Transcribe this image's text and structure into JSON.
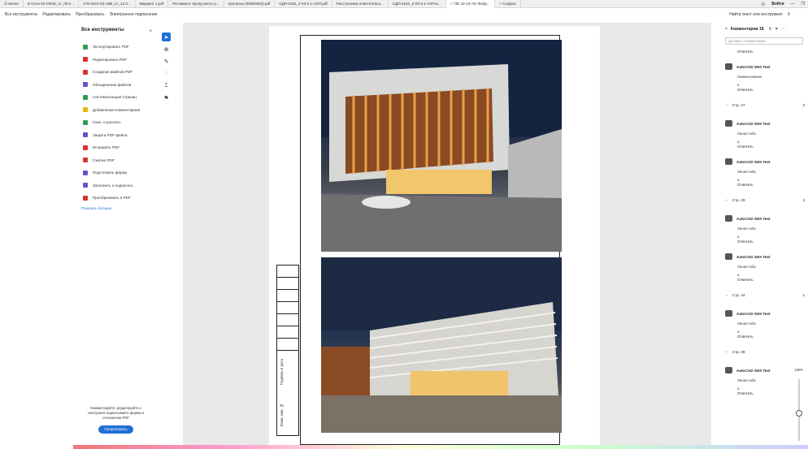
{
  "tabs": [
    {
      "label": "☰ Меню"
    },
    {
      "label": "E-Сети 03 УКОБ_от_05.0..."
    },
    {
      "label": "179-2021-03-АКБ_от_12.0..."
    },
    {
      "label": "Вариант 1.pdf"
    },
    {
      "label": "Регламент пропускного р..."
    },
    {
      "label": "пропуска (00000003).pdf"
    },
    {
      "label": "СДП-1162_2-03-3.1-АХП.pdf"
    },
    {
      "label": "Расстановка осветительн..."
    },
    {
      "label": "СДП-1162_2-03-3.1-АХП-в..."
    },
    {
      "label": "☆ ПЕ 42-10-АО Фабр..."
    },
    {
      "label": "+ Создать"
    }
  ],
  "window": {
    "help": "⓪",
    "login": "Войти",
    "minimize": "—",
    "restore": "❐"
  },
  "menubar": {
    "items": [
      "Все инструменты",
      "Редактировать",
      "Преобразовать",
      "Электронное подписание"
    ],
    "find": "Найти текст или инструмент",
    "find_icon": "search-icon"
  },
  "left_panel": {
    "title": "Все инструменты",
    "close": "×",
    "tools": [
      {
        "label": "Экспортировать PDF",
        "color": "#2e9e4f"
      },
      {
        "label": "Редактировать PDF",
        "color": "#d9342b"
      },
      {
        "label": "Создание файлов PDF",
        "color": "#d9342b"
      },
      {
        "label": "Объединение файлов",
        "color": "#6b4fd1"
      },
      {
        "label": "Систематизация страниц",
        "color": "#2e9e4f"
      },
      {
        "label": "Добавление комментариев",
        "color": "#e6b800"
      },
      {
        "label": "Скан. и распозн.",
        "color": "#2e9e4f"
      },
      {
        "label": "Защита PDF-файла",
        "color": "#6b4fd1"
      },
      {
        "label": "Исправить PDF",
        "color": "#d9342b"
      },
      {
        "label": "Сжатие PDF",
        "color": "#d9342b"
      },
      {
        "label": "Подготовить форму",
        "color": "#6b4fd1"
      },
      {
        "label": "Заполнить и подписать",
        "color": "#6b4fd1"
      },
      {
        "label": "Преобразовать в PDF",
        "color": "#d9342b"
      }
    ],
    "show_more": "Показать больше",
    "promo_text": "Комментируйте, редактируйте и электронно подписывайте формы и соглашения PDF",
    "promo_button": "Попробовать"
  },
  "vertical_tools": [
    "cursor-icon",
    "zoom-icon",
    "pen-icon",
    "lasso-icon",
    "text-select-icon",
    "stamp-icon"
  ],
  "document": {
    "stamp_labels": [
      "Подпись и дата",
      "Взам. инв. №"
    ]
  },
  "comments_panel": {
    "title": "Комментарии 18",
    "add_placeholder": "Добавить комментарий",
    "first_reply": "Ответить",
    "groups": [
      {
        "page": null,
        "count": null,
        "comments": [
          {
            "author": "AutoCAD SHX Text",
            "text": "Наименование",
            "a": "а",
            "reply": "Ответить"
          }
        ]
      },
      {
        "page": "Стр. 27",
        "count": "2",
        "comments": [
          {
            "author": "AutoCAD SHX Text",
            "text": "Линия гиба",
            "a": "а",
            "reply": "Ответить"
          },
          {
            "author": "AutoCAD SHX Text",
            "text": "Линия гиба",
            "a": "а",
            "reply": "Ответить"
          }
        ]
      },
      {
        "page": "Стр. 29",
        "count": "2",
        "comments": [
          {
            "author": "AutoCAD SHX Text",
            "text": "Линия гиба",
            "a": "а",
            "reply": "Ответить"
          },
          {
            "author": "AutoCAD SHX Text",
            "text": "Линия гиба",
            "a": "а",
            "reply": "Ответить"
          }
        ]
      },
      {
        "page": "Стр. 34",
        "count": "1",
        "comments": [
          {
            "author": "AutoCAD SHX Text",
            "text": "Линия гиба",
            "a": "а",
            "reply": "Ответить"
          }
        ]
      },
      {
        "page": "Стр. 38",
        "count": "",
        "comments": [
          {
            "author": "AutoCAD SHX Text",
            "text": "Линия гиба",
            "a": "а",
            "reply": "Ответить"
          }
        ]
      }
    ]
  },
  "zoom": {
    "label": "125%",
    "level": 0.5
  }
}
